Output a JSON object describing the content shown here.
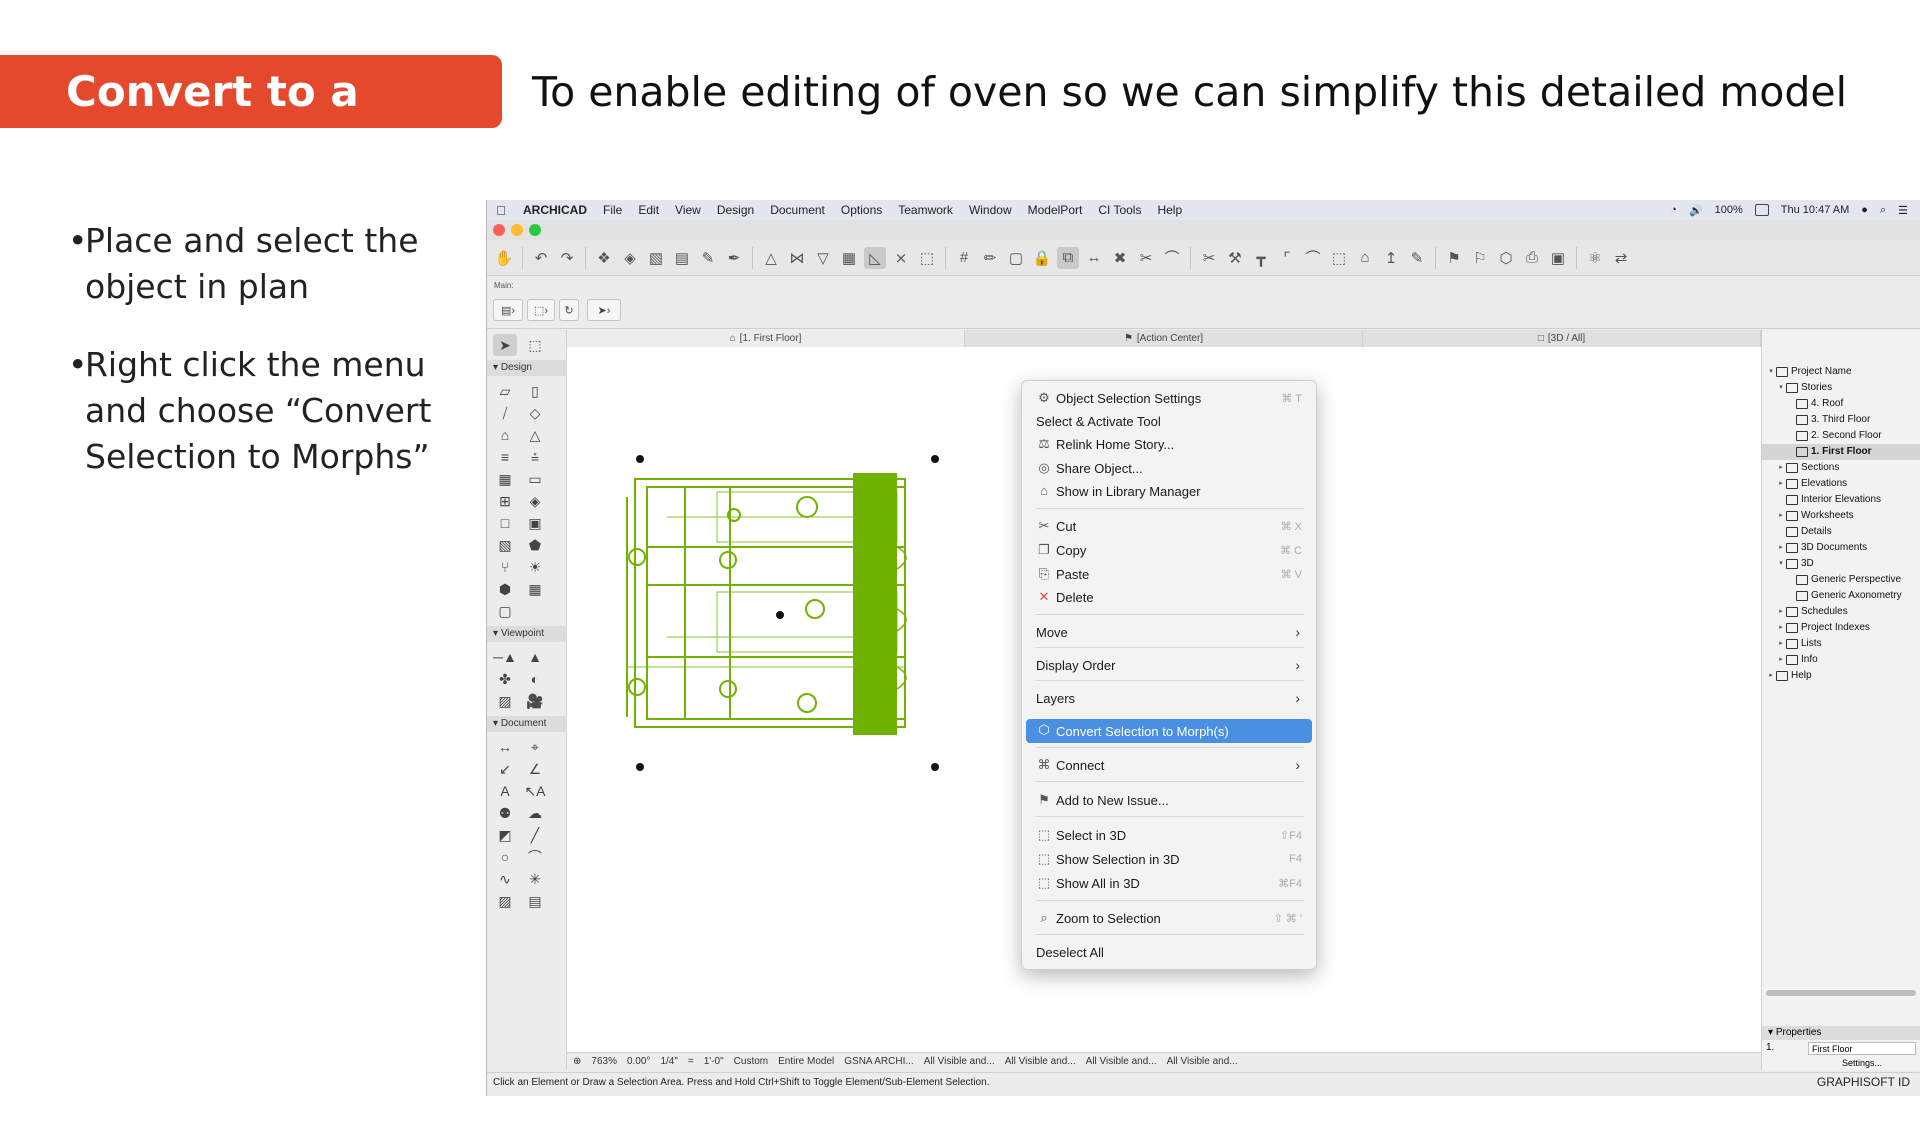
{
  "slide": {
    "title": "Convert to a Morph",
    "subtitle": "To enable editing of oven so we can simplify this detailed model",
    "bullets": [
      "Place and select the object in plan",
      "Right click the menu and choose “Convert Selection to Morphs”"
    ]
  },
  "menubar": {
    "app": "ARCHICAD",
    "items": [
      "File",
      "Edit",
      "View",
      "Design",
      "Document",
      "Options",
      "Teamwork",
      "Window",
      "ModelPort",
      "CI Tools",
      "Help"
    ],
    "battery": "100%",
    "clock": "Thu 10:47 AM"
  },
  "infobox": {
    "label": "Main:"
  },
  "tabs": [
    "[1. First Floor]",
    "[Action Center]",
    "[3D / All]"
  ],
  "toolbox": {
    "sections": [
      "Design",
      "Viewpoint",
      "Document"
    ]
  },
  "context_menu": {
    "items": [
      {
        "label": "Object Selection Settings",
        "shortcut": "⌘ T"
      },
      {
        "label": "Select & Activate Tool"
      },
      {
        "label": "Relink Home Story..."
      },
      {
        "label": "Share Object..."
      },
      {
        "label": "Show in Library Manager"
      },
      {
        "label": "Cut",
        "shortcut": "⌘ X"
      },
      {
        "label": "Copy",
        "shortcut": "⌘ C"
      },
      {
        "label": "Paste",
        "shortcut": "⌘ V"
      },
      {
        "label": "Delete"
      },
      {
        "label": "Move"
      },
      {
        "label": "Display Order"
      },
      {
        "label": "Layers"
      },
      {
        "label": "Convert Selection to Morph(s)"
      },
      {
        "label": "Connect"
      },
      {
        "label": "Add to New Issue..."
      },
      {
        "label": "Select in 3D",
        "shortcut": "⇧F4"
      },
      {
        "label": "Show Selection in 3D",
        "shortcut": "F4"
      },
      {
        "label": "Show All in 3D",
        "shortcut": "⌘F4"
      },
      {
        "label": "Zoom to Selection",
        "shortcut": "⇧ ⌘ '"
      },
      {
        "label": "Deselect All"
      }
    ]
  },
  "navigator": {
    "tree": [
      {
        "label": "Project Name"
      },
      {
        "label": "Stories"
      },
      {
        "label": "4. Roof"
      },
      {
        "label": "3. Third Floor"
      },
      {
        "label": "2. Second Floor"
      },
      {
        "label": "1. First Floor"
      },
      {
        "label": "Sections"
      },
      {
        "label": "Elevations"
      },
      {
        "label": "Interior Elevations"
      },
      {
        "label": "Worksheets"
      },
      {
        "label": "Details"
      },
      {
        "label": "3D Documents"
      },
      {
        "label": "3D"
      },
      {
        "label": "Generic Perspective"
      },
      {
        "label": "Generic Axonometry"
      },
      {
        "label": "Schedules"
      },
      {
        "label": "Project Indexes"
      },
      {
        "label": "Lists"
      },
      {
        "label": "Info"
      },
      {
        "label": "Help"
      }
    ],
    "properties": {
      "header": "Properties",
      "id": "1.",
      "name": "First Floor",
      "settings": "Settings..."
    }
  },
  "statusbar": {
    "zoom": "763%",
    "angle": "0.00°",
    "scale": "1/4\"",
    "scale_eq": "=",
    "scale_value": "1'-0\"",
    "pen": "Custom",
    "model": "Entire Model",
    "renovation": "GSNA ARCHI...",
    "layers": [
      "All Visible and...",
      "All Visible and...",
      "All Visible and...",
      "All Visible and..."
    ]
  },
  "hint": "Click an Element or Draw a Selection Area. Press and Hold Ctrl+Shift to Toggle Element/Sub-Element Selection.",
  "brand": "GRAPHISOFT ID",
  "colors": {
    "accent": "#e5492d",
    "highlight": "#4a90e2",
    "selection": "#6fb300"
  }
}
